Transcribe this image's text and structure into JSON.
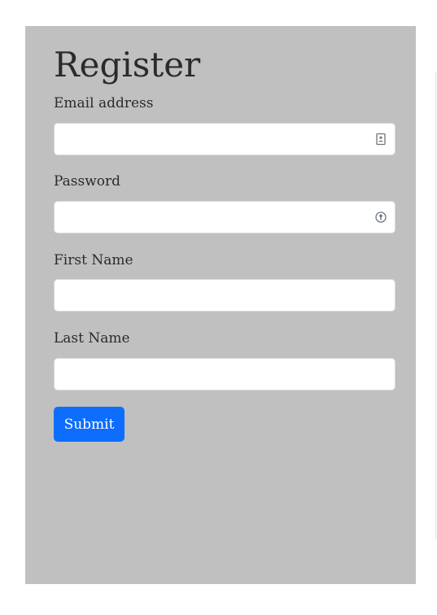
{
  "form": {
    "title": "Register",
    "email": {
      "label": "Email address",
      "value": "",
      "icon": "contact-card-icon"
    },
    "password": {
      "label": "Password",
      "value": "",
      "icon": "password-key-icon"
    },
    "first_name": {
      "label": "First Name",
      "value": ""
    },
    "last_name": {
      "label": "Last Name",
      "value": ""
    },
    "submit_label": "Submit"
  },
  "colors": {
    "panel_background": "#c0c0c0",
    "page_background": "#ffffff",
    "submit_button": "#0d6efd",
    "text": "#2b2b2b"
  }
}
